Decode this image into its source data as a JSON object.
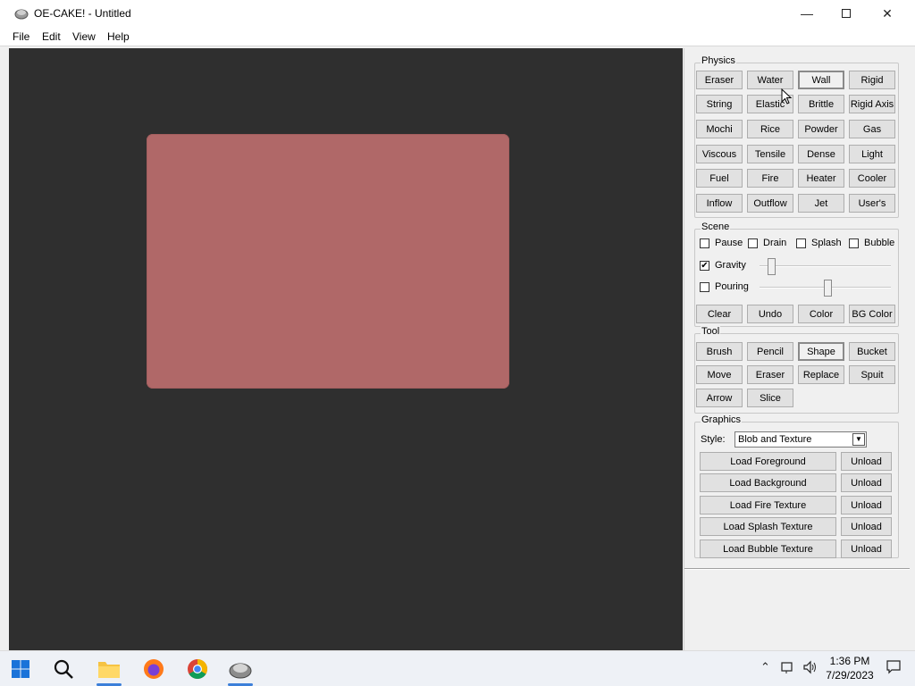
{
  "window": {
    "title": "OE-CAKE! - Untitled"
  },
  "menu": [
    "File",
    "Edit",
    "View",
    "Help"
  ],
  "physics": {
    "legend": "Physics",
    "buttons": [
      "Eraser",
      "Water",
      "Wall",
      "Rigid",
      "String",
      "Elastic",
      "Brittle",
      "Rigid Axis",
      "Mochi",
      "Rice",
      "Powder",
      "Gas",
      "Viscous",
      "Tensile",
      "Dense",
      "Light",
      "Fuel",
      "Fire",
      "Heater",
      "Cooler",
      "Inflow",
      "Outflow",
      "Jet",
      "User's"
    ],
    "selected": "Wall"
  },
  "scene": {
    "legend": "Scene",
    "checks": [
      {
        "label": "Pause",
        "checked": false
      },
      {
        "label": "Drain",
        "checked": false
      },
      {
        "label": "Splash",
        "checked": false
      },
      {
        "label": "Bubble",
        "checked": false
      }
    ],
    "gravity": {
      "label": "Gravity",
      "checked": true,
      "check_mark": "✔",
      "level": 0.09
    },
    "pouring": {
      "label": "Pouring",
      "checked": false,
      "level": 0.52
    },
    "buttons": [
      "Clear",
      "Undo",
      "Color",
      "BG Color"
    ]
  },
  "tool": {
    "legend": "Tool",
    "buttons": [
      "Brush",
      "Pencil",
      "Shape",
      "Bucket",
      "Move",
      "Eraser",
      "Replace",
      "Spuit",
      "Arrow",
      "Slice"
    ],
    "selected": "Shape"
  },
  "graphics": {
    "legend": "Graphics",
    "style_label": "Style:",
    "style_value": "Blob and Texture",
    "loads": [
      {
        "label": "Load Foreground",
        "unload": "Unload"
      },
      {
        "label": "Load Background",
        "unload": "Unload"
      },
      {
        "label": "Load Fire Texture",
        "unload": "Unload"
      },
      {
        "label": "Load Splash Texture",
        "unload": "Unload"
      },
      {
        "label": "Load Bubble Texture",
        "unload": "Unload"
      }
    ]
  },
  "taskbar": {
    "icons": [
      "windows-start-icon",
      "search-icon",
      "file-explorer-icon",
      "firefox-icon",
      "chrome-icon",
      "oe-cake-icon"
    ],
    "time": "1:36 PM",
    "date": "7/29/2023"
  },
  "colors": {
    "shape": "#b06868",
    "canvas": "#2f2f2f",
    "panel": "#f0f0f0"
  }
}
